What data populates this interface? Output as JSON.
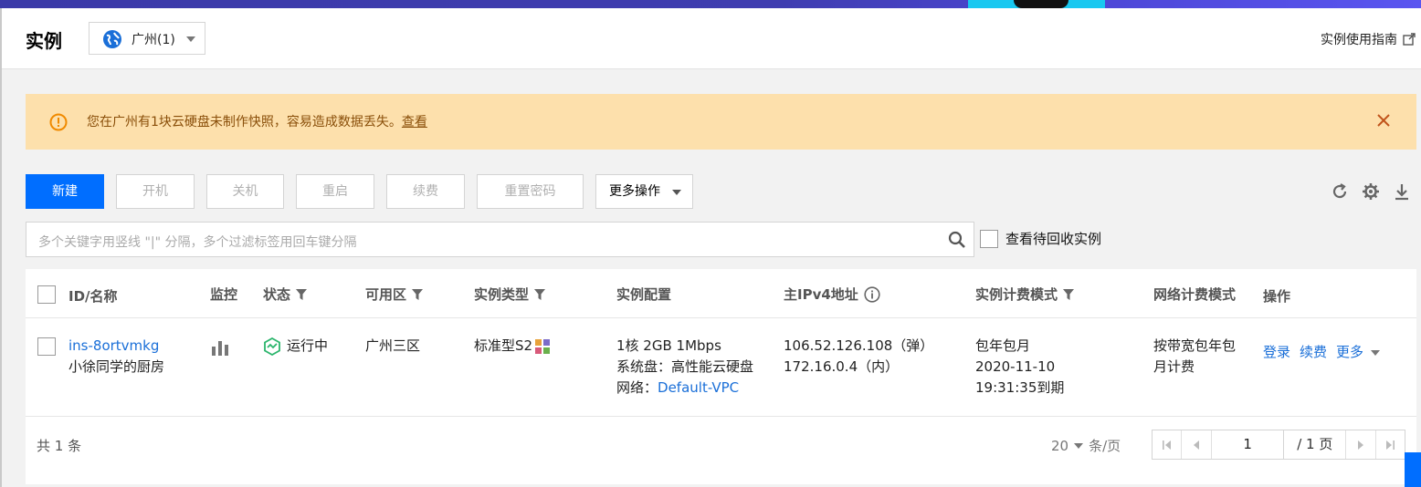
{
  "header": {
    "title": "实例",
    "region_label": "广州(1)",
    "guide_label": "实例使用指南"
  },
  "alert": {
    "text": "您在广州有1块云硬盘未制作快照，容易造成数据丢失。",
    "link": "查看"
  },
  "toolbar": {
    "new": "新建",
    "start": "开机",
    "stop": "关机",
    "restart": "重启",
    "renew": "续费",
    "reset_password": "重置密码",
    "more": "更多操作"
  },
  "search": {
    "placeholder": "多个关键字用竖线 \"|\" 分隔，多个过滤标签用回车键分隔",
    "recycle_label": "查看待回收实例"
  },
  "table": {
    "headers": {
      "id_name": "ID/名称",
      "monitor": "监控",
      "status": "状态",
      "zone": "可用区",
      "type": "实例类型",
      "config": "实例配置",
      "ipv4": "主IPv4地址",
      "billing": "实例计费模式",
      "net_billing": "网络计费模式",
      "ops": "操作"
    },
    "rows": [
      {
        "id": "ins-8ortvmkg",
        "name": "小徐同学的厨房",
        "status": "运行中",
        "zone": "广州三区",
        "type": "标准型S2",
        "config_line1": "1核 2GB 1Mbps",
        "config_line2": "系统盘：高性能云硬盘",
        "config_net_label": "网络：",
        "config_net_value": "Default-VPC",
        "ip_public": "106.52.126.108（弹）",
        "ip_private": "172.16.0.4（内）",
        "billing_line1": "包年包月",
        "billing_line2": "2020-11-10",
        "billing_line3": "19:31:35到期",
        "net_billing_line1": "按带宽包年包",
        "net_billing_line2": "月计费",
        "op_login": "登录",
        "op_renew": "续费",
        "op_more": "更多"
      }
    ]
  },
  "pagination": {
    "total_text": "共 1 条",
    "page_size": "20",
    "page_size_unit": "条/页",
    "current_page": "1",
    "total_pages_text": "/ 1 页"
  },
  "colors": {
    "primary": "#006eff",
    "alert_bg": "#fde0ac",
    "alert_text": "#8a4f0a",
    "status_green": "#2bb56c",
    "link": "#1a6fd8"
  }
}
